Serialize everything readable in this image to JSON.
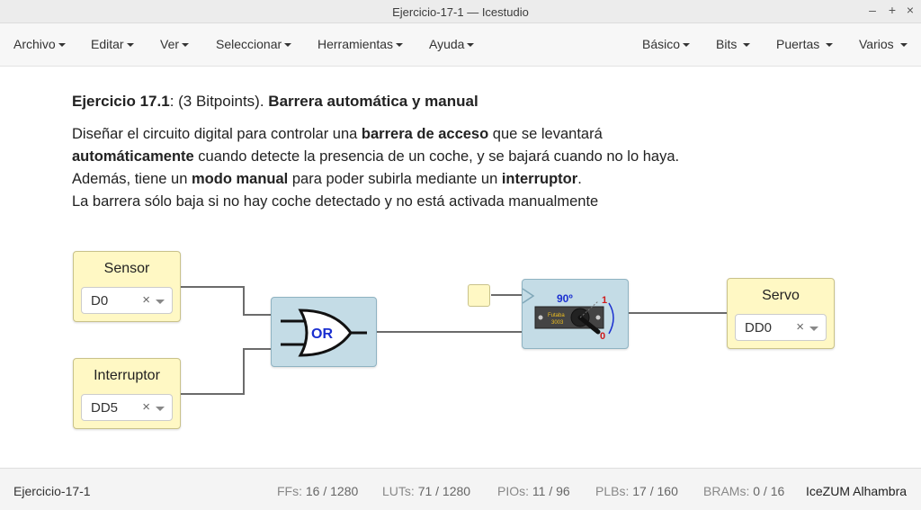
{
  "window": {
    "title": "Ejercicio-17-1 — Icestudio",
    "controls": [
      "–",
      "+",
      "×"
    ]
  },
  "menubar": {
    "left": [
      "Archivo",
      "Editar",
      "Ver",
      "Seleccionar",
      "Herramientas",
      "Ayuda"
    ],
    "right": [
      "Básico",
      "Bits",
      "Puertas",
      "Varios"
    ]
  },
  "exercise": {
    "heading_bold1": "Ejercicio 17.1",
    "heading_mid": ": (3 Bitpoints). ",
    "heading_bold2": "Barrera automática y manual",
    "line1_a": "Diseñar el circuito digital para controlar una ",
    "line1_b": "barrera de acceso",
    "line1_c": " que se levantará",
    "line2_a": "automáticamente",
    "line2_b": " cuando detecte la presencia de un coche, y se bajará cuando no lo haya.",
    "line3_a": "Además, tiene un ",
    "line3_b": "modo manual",
    "line3_c": " para poder subirla mediante un ",
    "line3_d": "interruptor",
    "line3_e": ".",
    "line4": "La barrera sólo baja si no hay coche detectado y no está activada manualmente"
  },
  "blocks": {
    "sensor": {
      "label": "Sensor",
      "pin": "D0",
      "clear": "×"
    },
    "interruptor": {
      "label": "Interruptor",
      "pin": "DD5",
      "clear": "×"
    },
    "servo": {
      "label": "Servo",
      "pin": "DD0",
      "clear": "×"
    },
    "or_gate": {
      "label": "OR"
    },
    "servo_module": {
      "angle": "90º",
      "brand": "Futaba",
      "model": "3003",
      "high": "1",
      "low": "0"
    }
  },
  "status": {
    "project": "Ejercicio-17-1",
    "ffs_label": "FFs:",
    "ffs": "16 / 1280",
    "luts_label": "LUTs:",
    "luts": "71 / 1280",
    "pios_label": "PIOs:",
    "pios": "11 / 96",
    "plbs_label": "PLBs:",
    "plbs": "17 / 160",
    "brams_label": "BRAMs:",
    "brams": "0 / 16",
    "board": "IceZUM Alhambra"
  }
}
